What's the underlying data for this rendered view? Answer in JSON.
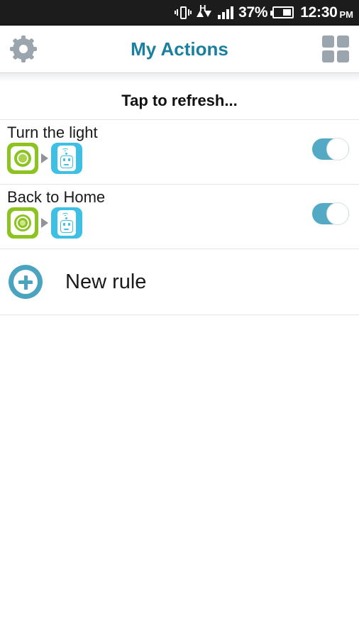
{
  "statusbar": {
    "icons": [
      "vibrate-icon",
      "hsdpa-data-icon",
      "signal-bars-icon",
      "battery-icon"
    ],
    "battery_percent": "37%",
    "time": "12:30",
    "ampm": "PM"
  },
  "header": {
    "title": "My Actions",
    "left_icon": "gear-icon",
    "right_icon": "grid-view-icon",
    "title_color": "#1b7f9e",
    "icon_color": "#9aa5ad"
  },
  "refresh": {
    "label": "Tap to refresh..."
  },
  "rules": [
    {
      "title": "Turn the light",
      "trigger_icon": "button-trigger-icon",
      "trigger_color": "#8cc320",
      "arrow_icon": "arrow-right-icon",
      "action_icon": "wifi-smart-plug-icon",
      "action_color": "#3ebfe4",
      "toggle_state": "on",
      "toggle_color": "#54a9c4"
    },
    {
      "title": "Back to Home",
      "trigger_icon": "geofence-trigger-icon",
      "trigger_color": "#8cc320",
      "arrow_icon": "arrow-right-icon",
      "action_icon": "wifi-smart-plug-icon",
      "action_color": "#3ebfe4",
      "toggle_state": "on",
      "toggle_color": "#54a9c4"
    }
  ],
  "new_rule": {
    "label": "New rule",
    "icon": "plus-circle-icon",
    "icon_color": "#4aa3bf"
  }
}
